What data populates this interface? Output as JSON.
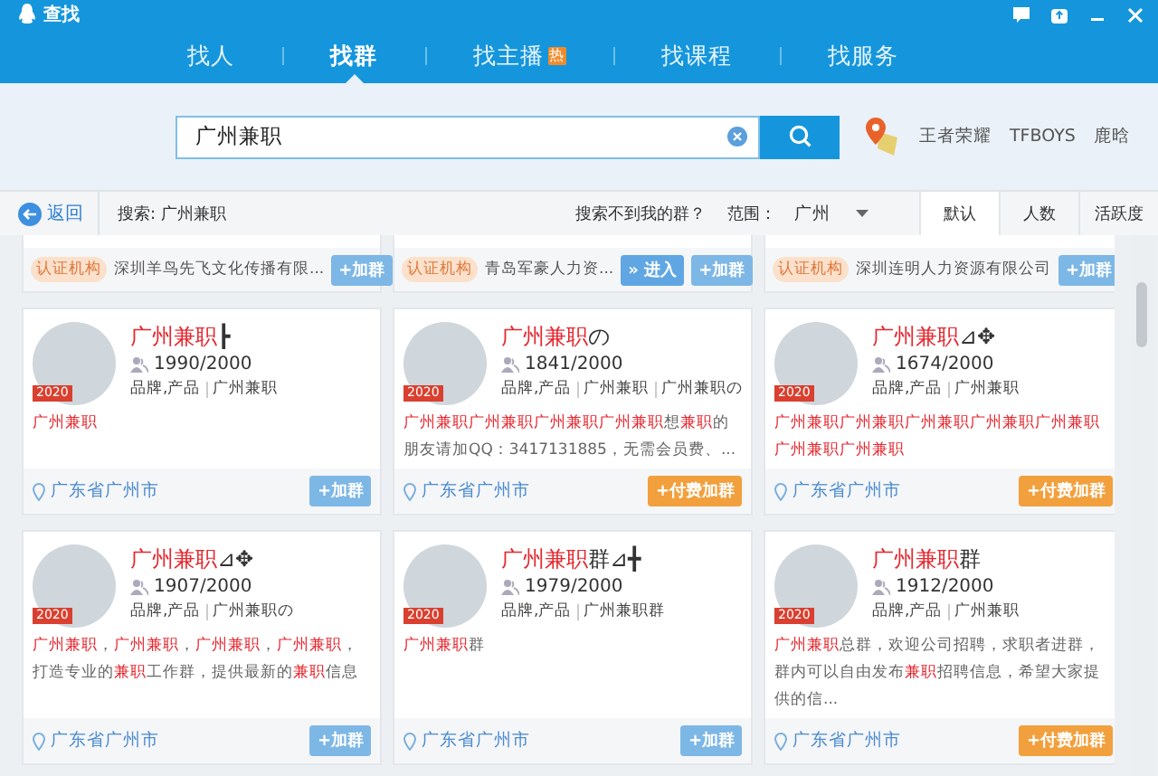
{
  "window": {
    "title": "查找"
  },
  "tabs": [
    {
      "label": "找人",
      "selected": false
    },
    {
      "label": "找群",
      "selected": true
    },
    {
      "label": "找主播",
      "selected": false,
      "badge": "热"
    },
    {
      "label": "找课程",
      "selected": false
    },
    {
      "label": "找服务",
      "selected": false
    }
  ],
  "search": {
    "value": "广州兼职"
  },
  "hot_words": [
    "王者荣耀",
    "TFBOYS",
    "鹿晗"
  ],
  "filter_bar": {
    "back": "返回",
    "query": "搜索: 广州兼职",
    "not_found": "搜索不到我的群？",
    "scope_label": "范围：",
    "scope": "广州",
    "sort_tabs": [
      {
        "label": "默认",
        "selected": true
      },
      {
        "label": "人数",
        "selected": false
      },
      {
        "label": "活跃度",
        "selected": false
      }
    ]
  },
  "top_cards": [
    {
      "cert": "认证机构",
      "org": "深圳羊鸟先飞文化传播有限...",
      "buttons": [
        {
          "label": "+加群",
          "kind": "join"
        }
      ]
    },
    {
      "cert": "认证机构",
      "org": "青岛军豪人力资...",
      "buttons": [
        {
          "label": "» 进入",
          "kind": "enter"
        },
        {
          "label": "+加群",
          "kind": "join"
        }
      ]
    },
    {
      "cert": "认证机构",
      "org": "深圳连明人力资源有限公司",
      "buttons": [
        {
          "label": "+加群",
          "kind": "join"
        }
      ]
    }
  ],
  "groups": [
    {
      "name": [
        {
          "text": "广州兼职",
          "highlighted": true
        },
        {
          "text": "┣",
          "highlighted": false
        }
      ],
      "badge": "2020",
      "members": "1990/2000",
      "tags": [
        "品牌,产品",
        "广州兼职"
      ],
      "description": [
        {
          "text": "广州兼职",
          "highlighted": true
        }
      ],
      "location": "广东省广州市",
      "button": {
        "label": "+加群",
        "kind": "join"
      }
    },
    {
      "name": [
        {
          "text": "广州兼职",
          "highlighted": true
        },
        {
          "text": "の",
          "highlighted": false
        }
      ],
      "badge": "2020",
      "members": "1841/2000",
      "tags": [
        "品牌,产品",
        "广州兼职",
        "广州兼职の"
      ],
      "description": [
        {
          "text": "广州兼职广州兼职广州兼职广州兼职",
          "highlighted": true
        },
        {
          "text": "想",
          "highlighted": false
        },
        {
          "text": "兼职",
          "highlighted": true
        },
        {
          "text": "的朋友请加QQ：3417131885，无需会员费、...",
          "highlighted": false
        }
      ],
      "location": "广东省广州市",
      "button": {
        "label": "+付费加群",
        "kind": "paid"
      }
    },
    {
      "name": [
        {
          "text": "广州兼职",
          "highlighted": true
        },
        {
          "text": "⊿✥",
          "highlighted": false
        }
      ],
      "badge": "2020",
      "members": "1674/2000",
      "tags": [
        "品牌,产品",
        "广州兼职"
      ],
      "description": [
        {
          "text": "广州兼职广州兼职广州兼职广州兼职广州兼职广州兼职广州兼职",
          "highlighted": true
        }
      ],
      "location": "广东省广州市",
      "button": {
        "label": "+付费加群",
        "kind": "paid"
      }
    },
    {
      "name": [
        {
          "text": "广州兼职",
          "highlighted": true
        },
        {
          "text": "⊿✥",
          "highlighted": false
        }
      ],
      "badge": "2020",
      "members": "1907/2000",
      "tags": [
        "品牌,产品",
        "广州兼职の"
      ],
      "description": [
        {
          "text": "广州兼职",
          "highlighted": true
        },
        {
          "text": "，",
          "highlighted": false
        },
        {
          "text": "广州兼职",
          "highlighted": true
        },
        {
          "text": "，",
          "highlighted": false
        },
        {
          "text": "广州兼职",
          "highlighted": true
        },
        {
          "text": "，",
          "highlighted": false
        },
        {
          "text": "广州兼职",
          "highlighted": true
        },
        {
          "text": "，打造专业的",
          "highlighted": false
        },
        {
          "text": "兼职",
          "highlighted": true
        },
        {
          "text": "工作群，提供最新的",
          "highlighted": false
        },
        {
          "text": "兼职",
          "highlighted": true
        },
        {
          "text": "信息",
          "highlighted": false
        }
      ],
      "location": "广东省广州市",
      "button": {
        "label": "+加群",
        "kind": "join"
      }
    },
    {
      "name": [
        {
          "text": "广州兼职",
          "highlighted": true
        },
        {
          "text": "群⊿╋",
          "highlighted": false
        }
      ],
      "badge": "2020",
      "members": "1979/2000",
      "tags": [
        "品牌,产品",
        "广州兼职群"
      ],
      "description": [
        {
          "text": "广州兼职",
          "highlighted": true
        },
        {
          "text": "群",
          "highlighted": false
        }
      ],
      "location": "广东省广州市",
      "button": {
        "label": "+加群",
        "kind": "join"
      }
    },
    {
      "name": [
        {
          "text": "广州兼职",
          "highlighted": true
        },
        {
          "text": "群",
          "highlighted": false
        }
      ],
      "badge": "2020",
      "members": "1912/2000",
      "tags": [
        "品牌,产品",
        "广州兼职"
      ],
      "description": [
        {
          "text": "广州兼职",
          "highlighted": true
        },
        {
          "text": "总群，欢迎公司招聘，求职者进群，群内可以自由发布",
          "highlighted": false
        },
        {
          "text": "兼职",
          "highlighted": true
        },
        {
          "text": "招聘信息，希望大家提供的信...",
          "highlighted": false
        }
      ],
      "location": "广东省广州市",
      "button": {
        "label": "+付费加群",
        "kind": "paid"
      }
    }
  ]
}
